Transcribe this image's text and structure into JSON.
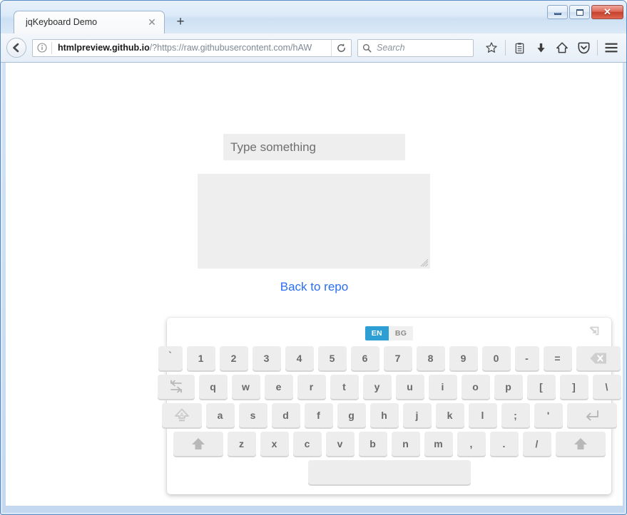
{
  "window": {
    "controls": {
      "minimize": "minimize-button",
      "maximize": "maximize-button",
      "close_label": "✕"
    }
  },
  "browser": {
    "tab": {
      "title": "jqKeyboard Demo",
      "close_label": "✕"
    },
    "new_tab_label": "+",
    "address": {
      "host": "htmlpreview.github.io",
      "path": "/?https://raw.githubusercontent.com/hAW",
      "full": "htmlpreview.github.io/?https://raw.githubusercontent.com/hAW"
    },
    "search": {
      "placeholder": "Search"
    },
    "icons": {
      "back": "back-arrow-icon",
      "info": "page-info-icon",
      "reload": "reload-icon",
      "search": "search-icon",
      "bookmark": "star-icon",
      "library": "library-icon",
      "downloads": "download-arrow-icon",
      "home": "home-icon",
      "pocket": "pocket-icon",
      "menu": "hamburger-menu-icon"
    }
  },
  "page": {
    "input": {
      "value": "",
      "placeholder": "Type something"
    },
    "textarea": {
      "value": "",
      "placeholder": ""
    },
    "link": {
      "label": "Back to repo"
    }
  },
  "keyboard": {
    "languages": [
      {
        "code": "EN",
        "active": true
      },
      {
        "code": "BG",
        "active": false
      }
    ],
    "minimize_icon": "minimize-keyboard-icon",
    "colors": {
      "accent": "#2d9fd4",
      "key_face": "#ededed",
      "key_shadow": "#d5d5d5",
      "key_text": "#6a6a6a"
    },
    "rows": [
      {
        "name": "number-row",
        "keys": [
          {
            "label": "`",
            "name": "key-backtick",
            "w": "w34"
          },
          {
            "label": "1",
            "name": "key-1",
            "w": "w40"
          },
          {
            "label": "2",
            "name": "key-2",
            "w": "w40"
          },
          {
            "label": "3",
            "name": "key-3",
            "w": "w40"
          },
          {
            "label": "4",
            "name": "key-4",
            "w": "w40"
          },
          {
            "label": "5",
            "name": "key-5",
            "w": "w40"
          },
          {
            "label": "6",
            "name": "key-6",
            "w": "w40"
          },
          {
            "label": "7",
            "name": "key-7",
            "w": "w40"
          },
          {
            "label": "8",
            "name": "key-8",
            "w": "w40"
          },
          {
            "label": "9",
            "name": "key-9",
            "w": "w40"
          },
          {
            "label": "0",
            "name": "key-0",
            "w": "w40"
          },
          {
            "label": "-",
            "name": "key-minus",
            "w": "w34"
          },
          {
            "label": "=",
            "name": "key-equals",
            "w": "w40"
          },
          {
            "label": "",
            "name": "key-backspace",
            "w": "w62",
            "icon": "backspace-icon"
          }
        ]
      },
      {
        "name": "top-letter-row",
        "keys": [
          {
            "label": "",
            "name": "key-tab",
            "w": "w52",
            "icon": "tab-icon"
          },
          {
            "label": "q",
            "name": "key-q",
            "w": "w40"
          },
          {
            "label": "w",
            "name": "key-w",
            "w": "w40"
          },
          {
            "label": "e",
            "name": "key-e",
            "w": "w40"
          },
          {
            "label": "r",
            "name": "key-r",
            "w": "w40"
          },
          {
            "label": "t",
            "name": "key-t",
            "w": "w40"
          },
          {
            "label": "y",
            "name": "key-y",
            "w": "w40"
          },
          {
            "label": "u",
            "name": "key-u",
            "w": "w40"
          },
          {
            "label": "i",
            "name": "key-i",
            "w": "w40"
          },
          {
            "label": "o",
            "name": "key-o",
            "w": "w40"
          },
          {
            "label": "p",
            "name": "key-p",
            "w": "w40"
          },
          {
            "label": "[",
            "name": "key-bracket-left",
            "w": "w40"
          },
          {
            "label": "]",
            "name": "key-bracket-right",
            "w": "w40"
          },
          {
            "label": "\\",
            "name": "key-backslash",
            "w": "w40"
          }
        ]
      },
      {
        "name": "home-row",
        "keys": [
          {
            "label": "",
            "name": "key-capslock",
            "w": "w56",
            "icon": "capslock-icon"
          },
          {
            "label": "a",
            "name": "key-a",
            "w": "w40"
          },
          {
            "label": "s",
            "name": "key-s",
            "w": "w40"
          },
          {
            "label": "d",
            "name": "key-d",
            "w": "w40"
          },
          {
            "label": "f",
            "name": "key-f",
            "w": "w40"
          },
          {
            "label": "g",
            "name": "key-g",
            "w": "w40"
          },
          {
            "label": "h",
            "name": "key-h",
            "w": "w40"
          },
          {
            "label": "j",
            "name": "key-j",
            "w": "w40"
          },
          {
            "label": "k",
            "name": "key-k",
            "w": "w40"
          },
          {
            "label": "l",
            "name": "key-l",
            "w": "w40"
          },
          {
            "label": ";",
            "name": "key-semicolon",
            "w": "w40"
          },
          {
            "label": "'",
            "name": "key-apostrophe",
            "w": "w40"
          },
          {
            "label": "",
            "name": "key-enter",
            "w": "w70",
            "icon": "enter-icon"
          }
        ]
      },
      {
        "name": "bottom-letter-row",
        "keys": [
          {
            "label": "",
            "name": "key-shift-left",
            "w": "w70",
            "icon": "shift-icon"
          },
          {
            "label": "z",
            "name": "key-z",
            "w": "w40"
          },
          {
            "label": "x",
            "name": "key-x",
            "w": "w40"
          },
          {
            "label": "c",
            "name": "key-c",
            "w": "w40"
          },
          {
            "label": "v",
            "name": "key-v",
            "w": "w40"
          },
          {
            "label": "b",
            "name": "key-b",
            "w": "w40"
          },
          {
            "label": "n",
            "name": "key-n",
            "w": "w40"
          },
          {
            "label": "m",
            "name": "key-m",
            "w": "w40"
          },
          {
            "label": ",",
            "name": "key-comma",
            "w": "w40"
          },
          {
            "label": ".",
            "name": "key-period",
            "w": "w40"
          },
          {
            "label": "/",
            "name": "key-slash",
            "w": "w40"
          },
          {
            "label": "",
            "name": "key-shift-right",
            "w": "w70",
            "icon": "shift-icon"
          }
        ]
      },
      {
        "name": "space-row",
        "keys": [
          {
            "label": "",
            "name": "key-space",
            "w": "space"
          }
        ]
      }
    ]
  }
}
